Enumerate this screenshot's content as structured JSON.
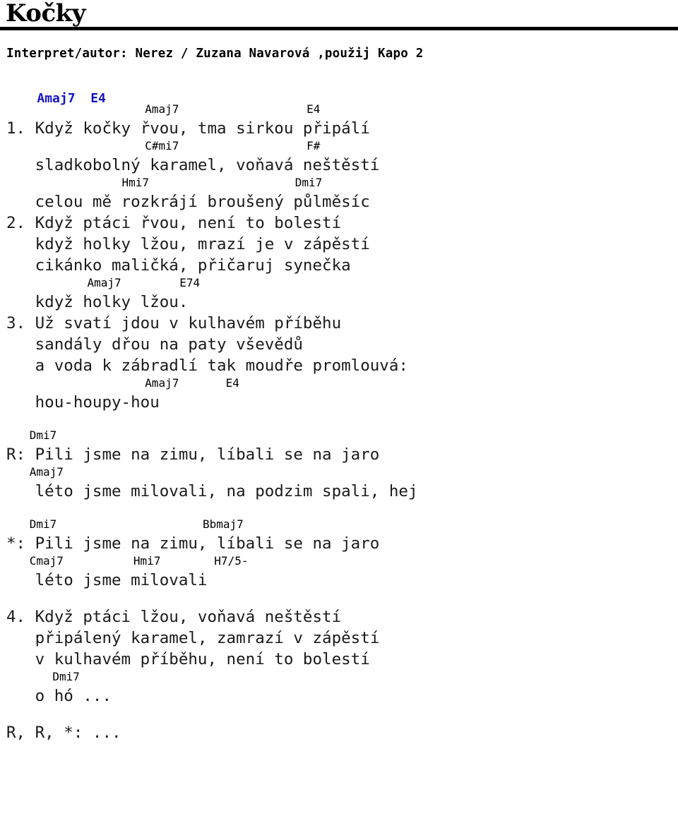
{
  "document": {
    "title": "Kočky",
    "subtitle": "Interpret/autor: Nerez / Zuzana Navarová ,použij Kapo 2",
    "chord_color": "#1414c8",
    "text_color": "#1a1a1a",
    "intro_chords": "Amaj7  E4"
  },
  "song": {
    "blocks": [
      {
        "id": "verse-1",
        "lines": [
          {
            "type": "chord",
            "chords": [
              {
                "col": 12,
                "name": "Amaj7"
              },
              {
                "col": 26,
                "name": "E4"
              }
            ]
          },
          {
            "type": "lyric",
            "text": "1. Když kočky řvou, tma sirkou připálí"
          },
          {
            "type": "chord",
            "chords": [
              {
                "col": 12,
                "name": "C#mi7"
              },
              {
                "col": 26,
                "name": "F#"
              }
            ]
          },
          {
            "type": "lyric",
            "text": "   sladkobolný karamel, voňavá neštěstí"
          },
          {
            "type": "chord",
            "chords": [
              {
                "col": 10,
                "name": "Hmi7"
              },
              {
                "col": 25,
                "name": "Dmi7"
              }
            ]
          },
          {
            "type": "lyric",
            "text": "   celou mě rozkrájí broušený půlměsíc"
          }
        ]
      },
      {
        "id": "verse-2",
        "lines": [
          {
            "type": "lyric",
            "text": "2. Když ptáci řvou, není to bolestí"
          },
          {
            "type": "lyric",
            "text": "   když holky lžou, mrazí je v zápěstí"
          },
          {
            "type": "lyric",
            "text": "   cikánko maličká, přičaruj synečka"
          },
          {
            "type": "chord",
            "chords": [
              {
                "col": 7,
                "name": "Amaj7"
              },
              {
                "col": 15,
                "name": "E74"
              }
            ]
          },
          {
            "type": "lyric",
            "text": "   když holky lžou."
          }
        ]
      },
      {
        "id": "verse-3",
        "lines": [
          {
            "type": "lyric",
            "text": "3. Už svatí jdou v kulhavém příběhu"
          },
          {
            "type": "lyric",
            "text": "   sandály dřou na paty vševědů"
          },
          {
            "type": "lyric",
            "text": "   a voda k zábradlí tak moudře promlouvá:"
          },
          {
            "type": "chord",
            "chords": [
              {
                "col": 12,
                "name": "Amaj7"
              },
              {
                "col": 19,
                "name": "E4"
              }
            ]
          },
          {
            "type": "lyric",
            "text": "   hou-houpy-hou"
          }
        ]
      },
      {
        "id": "refrain-r",
        "spacer": true,
        "lines": [
          {
            "type": "chord",
            "chords": [
              {
                "col": 2,
                "name": "Dmi7"
              }
            ]
          },
          {
            "type": "lyric",
            "text": "R: Pili jsme na zimu, líbali se na jaro"
          },
          {
            "type": "chord",
            "chords": [
              {
                "col": 2,
                "name": "Amaj7"
              }
            ]
          },
          {
            "type": "lyric",
            "text": "   léto jsme milovali, na podzim spali, hej"
          }
        ]
      },
      {
        "id": "refrain-star",
        "spacer": true,
        "lines": [
          {
            "type": "chord",
            "chords": [
              {
                "col": 2,
                "name": "Dmi7"
              },
              {
                "col": 17,
                "name": "Bbmaj7"
              }
            ]
          },
          {
            "type": "lyric",
            "text": "*: Pili jsme na zimu, líbali se na jaro"
          },
          {
            "type": "chord",
            "chords": [
              {
                "col": 2,
                "name": "Cmaj7"
              },
              {
                "col": 11,
                "name": "Hmi7"
              },
              {
                "col": 18,
                "name": "H7/5-"
              }
            ]
          },
          {
            "type": "lyric",
            "text": "   léto jsme milovali"
          }
        ]
      },
      {
        "id": "verse-4",
        "spacer": true,
        "lines": [
          {
            "type": "lyric",
            "text": "4. Když ptáci lžou, voňavá neštěstí"
          },
          {
            "type": "lyric",
            "text": "   připálený karamel, zamrazí v zápěstí"
          },
          {
            "type": "lyric",
            "text": "   v kulhavém příběhu, není to bolestí"
          },
          {
            "type": "chord",
            "chords": [
              {
                "col": 4,
                "name": "Dmi7"
              }
            ]
          },
          {
            "type": "lyric",
            "text": "   o hó ..."
          }
        ]
      },
      {
        "id": "outro",
        "spacer": true,
        "lines": [
          {
            "type": "lyric",
            "text": "R, R, *: ..."
          }
        ]
      }
    ]
  }
}
